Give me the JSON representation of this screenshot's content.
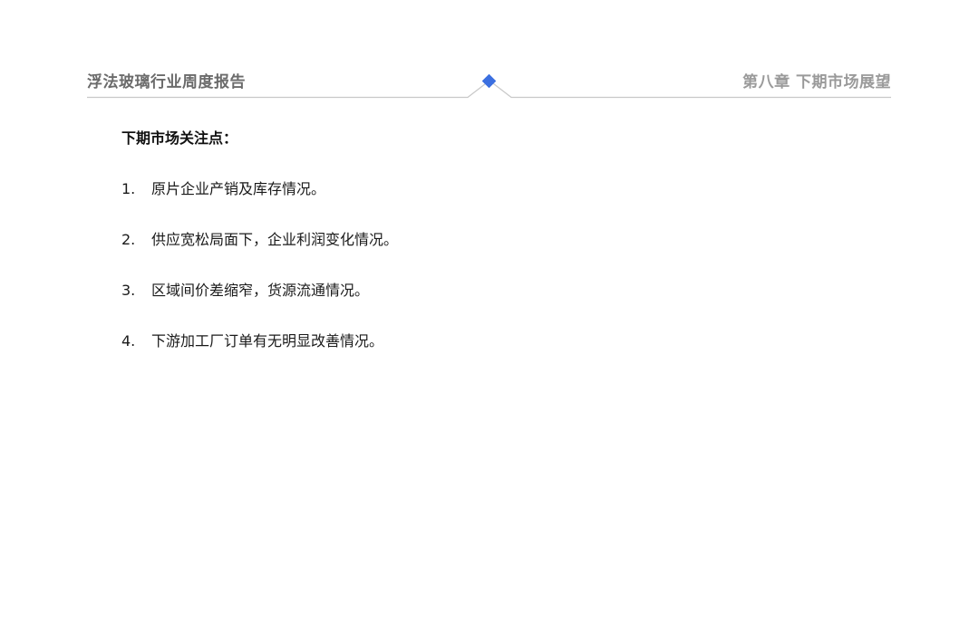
{
  "header": {
    "report_title": "浮法玻璃行业周度报告",
    "chapter_title": "第八章  下期市场展望",
    "accent_color": "#3b6fe0",
    "rule_color": "#c8c8c8"
  },
  "main": {
    "heading": "下期市场关注点：",
    "items": [
      {
        "number": "1.",
        "text": "原片企业产销及库存情况。"
      },
      {
        "number": "2.",
        "text": "供应宽松局面下，企业利润变化情况。"
      },
      {
        "number": "3.",
        "text": "区域间价差缩窄，货源流通情况。"
      },
      {
        "number": "4.",
        "text": "下游加工厂订单有无明显改善情况。"
      }
    ]
  }
}
